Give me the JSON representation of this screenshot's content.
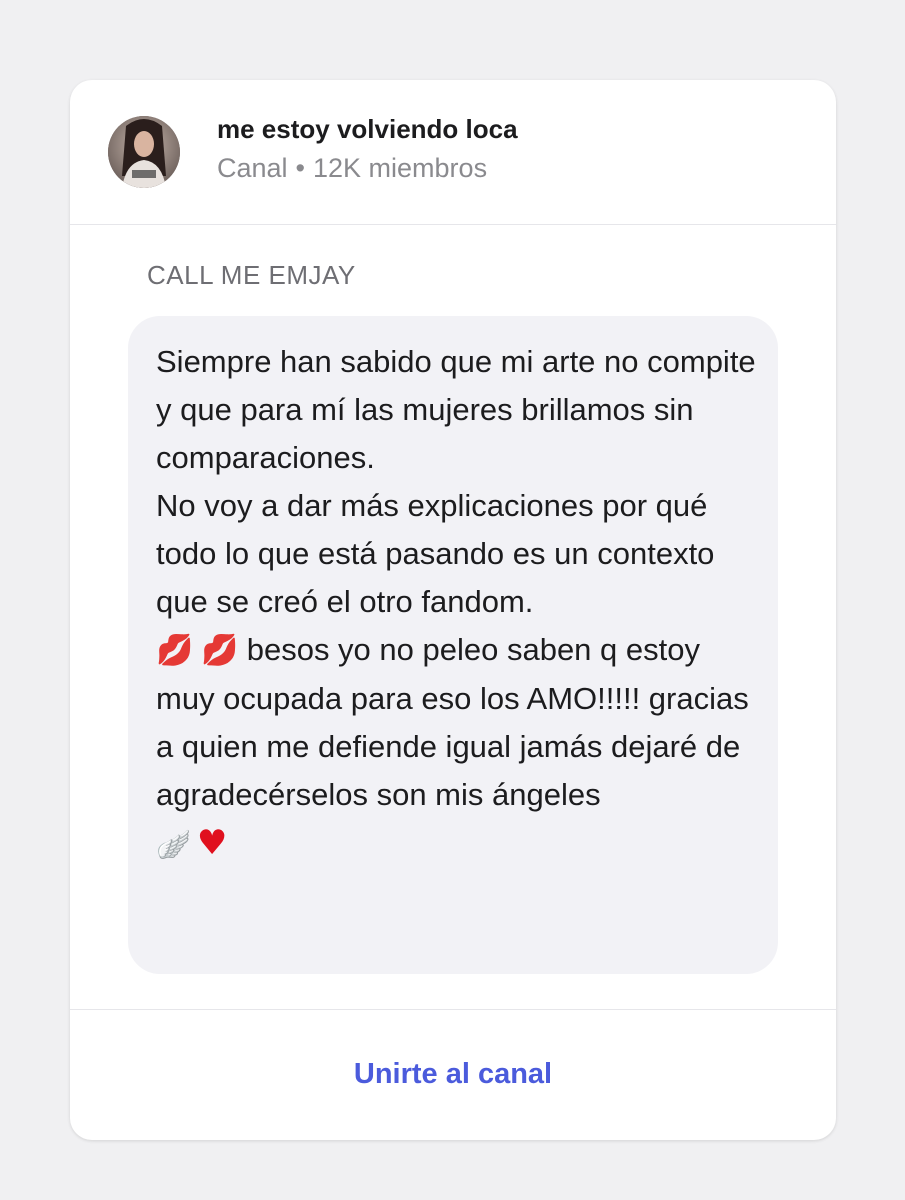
{
  "header": {
    "channel_name": "me estoy volviendo loca",
    "channel_type": "Canal",
    "separator": "•",
    "member_count": "12K miembros"
  },
  "post": {
    "author": "CALL ME EMJAY",
    "paragraph_1": "Siempre han sabido que mi arte no compite y que para mí las mujeres brillamos sin comparaciones.",
    "paragraph_2": "No voy a dar más explicaciones por qué todo lo que está pasando es un contexto que se creó el otro fandom.",
    "kiss_emoji": "💋",
    "paragraph_3": "besos yo no peleo saben q estoy muy ocupada para eso los AMO!!!!! gracias a quien me defiende igual jamás dejaré de agradecérselos son mis ángeles",
    "wing_emoji": "🪽",
    "heart_emoji": "♥"
  },
  "footer": {
    "join_label": "Unirte al canal"
  },
  "colors": {
    "accent": "#4b5bdc",
    "bubble": "#f2f2f6",
    "secondary_text": "#8a8a8e",
    "heart": "#e0101e"
  },
  "icons": {
    "avatar": "channel-avatar-photo",
    "kiss": "kiss-mark-icon",
    "wing": "wing-icon",
    "heart": "red-heart-icon"
  }
}
